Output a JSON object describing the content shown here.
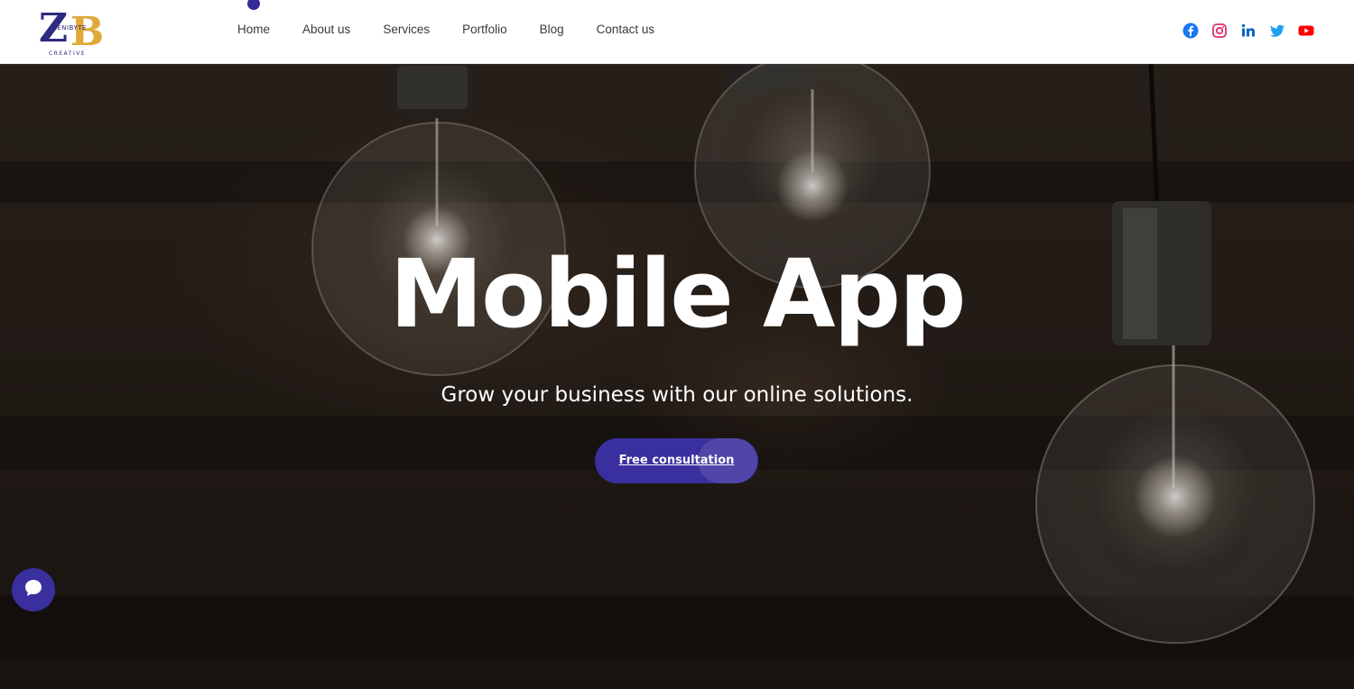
{
  "brand": {
    "logo_letters": "ZB",
    "logo_name": "ZENIBYTE",
    "logo_tagline": "CREATIVE",
    "colors": {
      "primary": "#352a9c",
      "accent_gold": "#e0a93a"
    }
  },
  "nav": {
    "items": [
      {
        "label": "Home",
        "active": true
      },
      {
        "label": "About us"
      },
      {
        "label": "Services"
      },
      {
        "label": "Portfolio"
      },
      {
        "label": "Blog"
      },
      {
        "label": "Contact us"
      }
    ]
  },
  "socials": [
    {
      "icon": "facebook-icon",
      "color": "#1877f2"
    },
    {
      "icon": "instagram-icon",
      "color": "#e1306c"
    },
    {
      "icon": "linkedin-icon",
      "color": "#0a66c2"
    },
    {
      "icon": "twitter-icon",
      "color": "#1da1f2"
    },
    {
      "icon": "youtube-icon",
      "color": "#ff0000"
    }
  ],
  "hero": {
    "title": "Mobile App",
    "subtitle": "Grow your business with our online solutions.",
    "cta_label": "Free consultation"
  },
  "chat": {
    "icon": "chat-bubble-icon"
  }
}
